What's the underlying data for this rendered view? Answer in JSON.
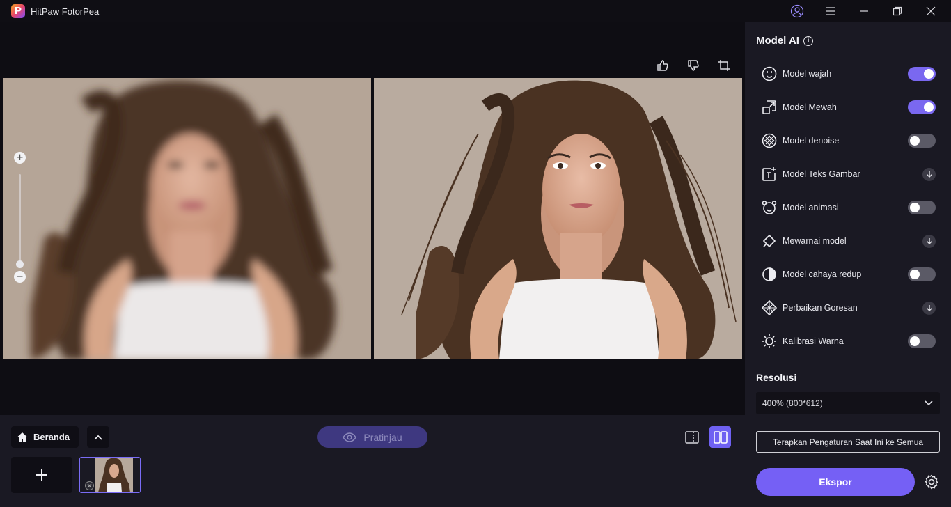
{
  "app": {
    "title": "HitPaw FotorPea",
    "logo_letter": "P"
  },
  "preview_button": {
    "label": "Pratinjau"
  },
  "home_button": {
    "label": "Beranda"
  },
  "model_panel": {
    "title": "Model AI",
    "info": "i",
    "models": [
      {
        "label": "Model wajah",
        "control": "toggle",
        "on": true
      },
      {
        "label": "Model Mewah",
        "control": "toggle",
        "on": true
      },
      {
        "label": "Model denoise",
        "control": "toggle",
        "on": false
      },
      {
        "label": "Model Teks Gambar",
        "control": "download"
      },
      {
        "label": "Model animasi",
        "control": "toggle",
        "on": false
      },
      {
        "label": "Mewarnai model",
        "control": "download"
      },
      {
        "label": "Model cahaya redup",
        "control": "toggle",
        "on": false
      },
      {
        "label": "Perbaikan Goresan",
        "control": "download"
      },
      {
        "label": "Kalibrasi Warna",
        "control": "toggle",
        "on": false
      }
    ]
  },
  "resolution": {
    "title": "Resolusi",
    "selected": "400% (800*612)"
  },
  "apply_all": {
    "label": "Terapkan Pengaturan Saat Ini ke Semua"
  },
  "export": {
    "label": "Ekspor"
  },
  "colors": {
    "accent": "#7560f5",
    "panel_bg": "#1a1923",
    "canvas_bg": "#0e0d13"
  }
}
